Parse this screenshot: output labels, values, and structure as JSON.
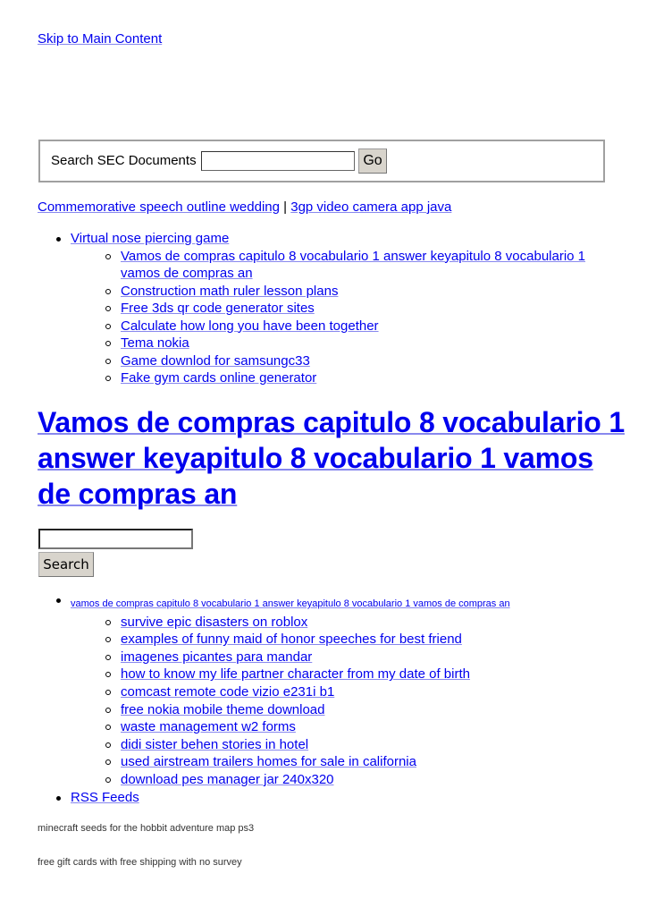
{
  "skip_link": "Skip to Main Content",
  "sec_search": {
    "label": "Search SEC Documents",
    "value": "",
    "button": "Go"
  },
  "crumbs": {
    "link1": "Commemorative speech outline wedding",
    "separator": "|",
    "link2": "3gp video camera app java"
  },
  "nav_list": {
    "top_item": "Virtual nose piercing game",
    "sub_items": [
      "Vamos de compras capitulo 8 vocabulario 1 answer keyapitulo 8 vocabulario 1 vamos de compras an",
      "Construction math ruler lesson plans",
      "Free 3ds qr code generator sites",
      "Calculate how long you have been together",
      "Tema nokia",
      "Game downlod for samsungc33",
      "Fake gym cards online generator"
    ]
  },
  "page_title": "Vamos de compras capitulo 8 vocabulario 1 answer keyapitulo 8 vocabulario 1 vamos de compras an",
  "site_search": {
    "value": "",
    "button": "Search"
  },
  "content_list": {
    "top_item": "vamos de compras capitulo 8 vocabulario 1 answer keyapitulo 8 vocabulario 1 vamos de compras an",
    "sub_items": [
      "survive epic disasters on roblox",
      "examples of funny maid of honor speeches for best friend",
      "imagenes picantes para mandar",
      "how to know my life partner character from my date of birth",
      "comcast remote code vizio e231i b1",
      "free nokia mobile theme download",
      "waste management w2 forms",
      "didi sister behen stories in hotel",
      "used airstream trailers homes for sale in california",
      "download pes manager jar 240x320"
    ],
    "rss": "RSS Feeds"
  },
  "footer": {
    "line1": "minecraft seeds for the hobbit adventure map ps3",
    "line2": "free gift cards with free shipping with no survey"
  }
}
